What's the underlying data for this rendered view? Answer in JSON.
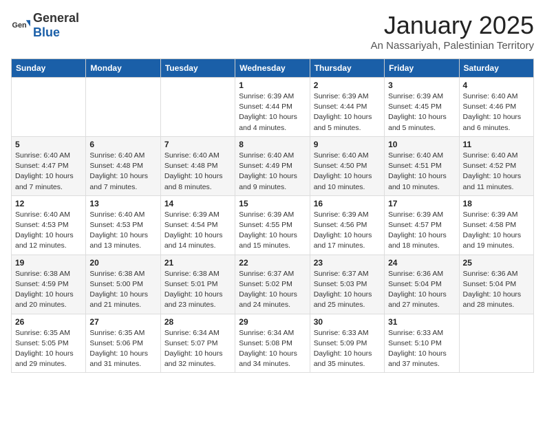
{
  "header": {
    "logo_general": "General",
    "logo_blue": "Blue",
    "month": "January 2025",
    "location": "An Nassariyah, Palestinian Territory"
  },
  "weekdays": [
    "Sunday",
    "Monday",
    "Tuesday",
    "Wednesday",
    "Thursday",
    "Friday",
    "Saturday"
  ],
  "weeks": [
    [
      {
        "day": "",
        "info": ""
      },
      {
        "day": "",
        "info": ""
      },
      {
        "day": "",
        "info": ""
      },
      {
        "day": "1",
        "info": "Sunrise: 6:39 AM\nSunset: 4:44 PM\nDaylight: 10 hours and 4 minutes."
      },
      {
        "day": "2",
        "info": "Sunrise: 6:39 AM\nSunset: 4:44 PM\nDaylight: 10 hours and 5 minutes."
      },
      {
        "day": "3",
        "info": "Sunrise: 6:39 AM\nSunset: 4:45 PM\nDaylight: 10 hours and 5 minutes."
      },
      {
        "day": "4",
        "info": "Sunrise: 6:40 AM\nSunset: 4:46 PM\nDaylight: 10 hours and 6 minutes."
      }
    ],
    [
      {
        "day": "5",
        "info": "Sunrise: 6:40 AM\nSunset: 4:47 PM\nDaylight: 10 hours and 7 minutes."
      },
      {
        "day": "6",
        "info": "Sunrise: 6:40 AM\nSunset: 4:48 PM\nDaylight: 10 hours and 7 minutes."
      },
      {
        "day": "7",
        "info": "Sunrise: 6:40 AM\nSunset: 4:48 PM\nDaylight: 10 hours and 8 minutes."
      },
      {
        "day": "8",
        "info": "Sunrise: 6:40 AM\nSunset: 4:49 PM\nDaylight: 10 hours and 9 minutes."
      },
      {
        "day": "9",
        "info": "Sunrise: 6:40 AM\nSunset: 4:50 PM\nDaylight: 10 hours and 10 minutes."
      },
      {
        "day": "10",
        "info": "Sunrise: 6:40 AM\nSunset: 4:51 PM\nDaylight: 10 hours and 10 minutes."
      },
      {
        "day": "11",
        "info": "Sunrise: 6:40 AM\nSunset: 4:52 PM\nDaylight: 10 hours and 11 minutes."
      }
    ],
    [
      {
        "day": "12",
        "info": "Sunrise: 6:40 AM\nSunset: 4:53 PM\nDaylight: 10 hours and 12 minutes."
      },
      {
        "day": "13",
        "info": "Sunrise: 6:40 AM\nSunset: 4:53 PM\nDaylight: 10 hours and 13 minutes."
      },
      {
        "day": "14",
        "info": "Sunrise: 6:39 AM\nSunset: 4:54 PM\nDaylight: 10 hours and 14 minutes."
      },
      {
        "day": "15",
        "info": "Sunrise: 6:39 AM\nSunset: 4:55 PM\nDaylight: 10 hours and 15 minutes."
      },
      {
        "day": "16",
        "info": "Sunrise: 6:39 AM\nSunset: 4:56 PM\nDaylight: 10 hours and 17 minutes."
      },
      {
        "day": "17",
        "info": "Sunrise: 6:39 AM\nSunset: 4:57 PM\nDaylight: 10 hours and 18 minutes."
      },
      {
        "day": "18",
        "info": "Sunrise: 6:39 AM\nSunset: 4:58 PM\nDaylight: 10 hours and 19 minutes."
      }
    ],
    [
      {
        "day": "19",
        "info": "Sunrise: 6:38 AM\nSunset: 4:59 PM\nDaylight: 10 hours and 20 minutes."
      },
      {
        "day": "20",
        "info": "Sunrise: 6:38 AM\nSunset: 5:00 PM\nDaylight: 10 hours and 21 minutes."
      },
      {
        "day": "21",
        "info": "Sunrise: 6:38 AM\nSunset: 5:01 PM\nDaylight: 10 hours and 23 minutes."
      },
      {
        "day": "22",
        "info": "Sunrise: 6:37 AM\nSunset: 5:02 PM\nDaylight: 10 hours and 24 minutes."
      },
      {
        "day": "23",
        "info": "Sunrise: 6:37 AM\nSunset: 5:03 PM\nDaylight: 10 hours and 25 minutes."
      },
      {
        "day": "24",
        "info": "Sunrise: 6:36 AM\nSunset: 5:04 PM\nDaylight: 10 hours and 27 minutes."
      },
      {
        "day": "25",
        "info": "Sunrise: 6:36 AM\nSunset: 5:04 PM\nDaylight: 10 hours and 28 minutes."
      }
    ],
    [
      {
        "day": "26",
        "info": "Sunrise: 6:35 AM\nSunset: 5:05 PM\nDaylight: 10 hours and 29 minutes."
      },
      {
        "day": "27",
        "info": "Sunrise: 6:35 AM\nSunset: 5:06 PM\nDaylight: 10 hours and 31 minutes."
      },
      {
        "day": "28",
        "info": "Sunrise: 6:34 AM\nSunset: 5:07 PM\nDaylight: 10 hours and 32 minutes."
      },
      {
        "day": "29",
        "info": "Sunrise: 6:34 AM\nSunset: 5:08 PM\nDaylight: 10 hours and 34 minutes."
      },
      {
        "day": "30",
        "info": "Sunrise: 6:33 AM\nSunset: 5:09 PM\nDaylight: 10 hours and 35 minutes."
      },
      {
        "day": "31",
        "info": "Sunrise: 6:33 AM\nSunset: 5:10 PM\nDaylight: 10 hours and 37 minutes."
      },
      {
        "day": "",
        "info": ""
      }
    ]
  ]
}
